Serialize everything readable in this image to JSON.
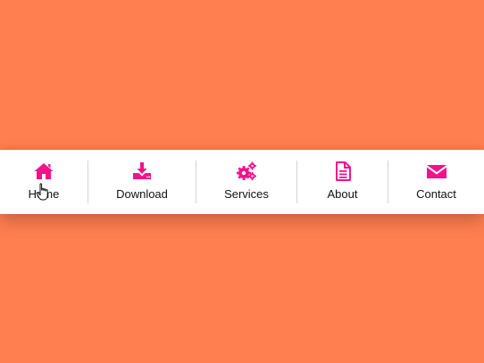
{
  "theme": {
    "background": "#FF7F50",
    "bar_background": "#FFFFFF",
    "icon_color": "#F0148C",
    "text_color": "#111111"
  },
  "nav": {
    "items": [
      {
        "label": "Home",
        "icon": "home-icon"
      },
      {
        "label": "Download",
        "icon": "download-icon"
      },
      {
        "label": "Services",
        "icon": "gears-icon"
      },
      {
        "label": "About",
        "icon": "document-icon"
      },
      {
        "label": "Contact",
        "icon": "envelope-icon"
      }
    ]
  }
}
